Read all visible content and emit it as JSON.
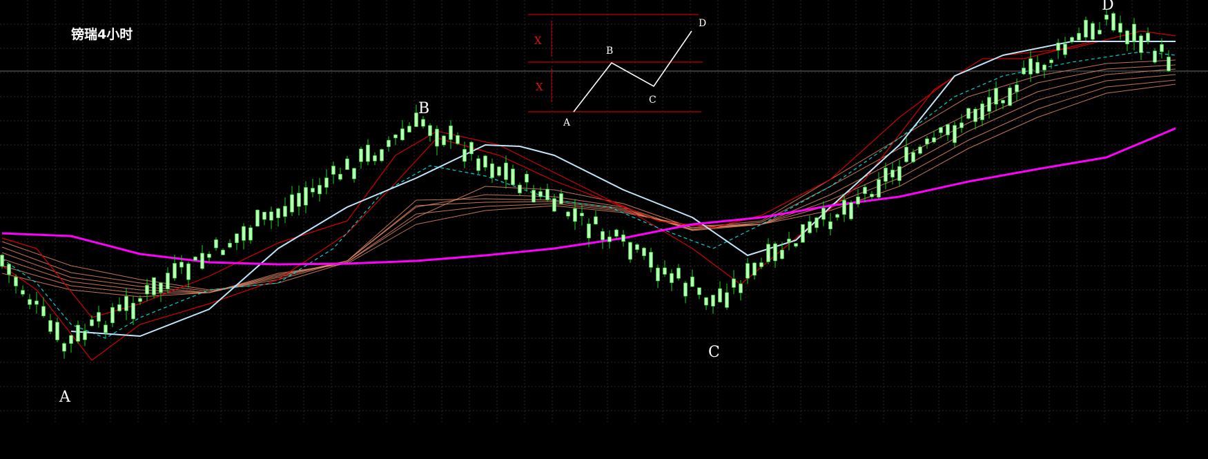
{
  "chart_data": {
    "type": "candlestick",
    "title": "镑瑞4小时",
    "background": "#000000",
    "grid": true,
    "grid_color": "#2a2a2a",
    "colors": {
      "candle": "#b9ffb9",
      "wick": "#21d321",
      "ma_slow": "#ff00ff",
      "ma_light": "#bfe6ff",
      "ma_dashed": "#00d4d4",
      "envelope": "#d40000",
      "ribbon": "#e58a64"
    },
    "wave_points": [
      {
        "label": "A",
        "index": 9,
        "price": 502
      },
      {
        "label": "B",
        "index": 61,
        "price": 177
      },
      {
        "label": "C",
        "index": 103,
        "price": 437
      },
      {
        "label": "D",
        "index": 160,
        "price": 27
      }
    ],
    "series": [
      {
        "type": "ma_slow",
        "points": [
          [
            0,
            338
          ],
          [
            10,
            342
          ],
          [
            20,
            368
          ],
          [
            30,
            380
          ],
          [
            40,
            383
          ],
          [
            50,
            382
          ],
          [
            60,
            378
          ],
          [
            70,
            370
          ],
          [
            80,
            360
          ],
          [
            90,
            345
          ],
          [
            100,
            325
          ],
          [
            110,
            315
          ],
          [
            120,
            298
          ],
          [
            130,
            285
          ],
          [
            140,
            263
          ],
          [
            150,
            245
          ],
          [
            160,
            228
          ],
          [
            170,
            186
          ]
        ]
      },
      {
        "type": "ma_light",
        "points": [
          [
            10,
            480
          ],
          [
            20,
            487
          ],
          [
            30,
            448
          ],
          [
            40,
            360
          ],
          [
            50,
            300
          ],
          [
            60,
            258
          ],
          [
            70,
            210
          ],
          [
            75,
            212
          ],
          [
            80,
            225
          ],
          [
            90,
            275
          ],
          [
            100,
            315
          ],
          [
            108,
            370
          ],
          [
            115,
            348
          ],
          [
            120,
            300
          ],
          [
            130,
            210
          ],
          [
            138,
            110
          ],
          [
            145,
            80
          ],
          [
            155,
            60
          ],
          [
            170,
            60
          ]
        ]
      },
      {
        "type": "ma_dashed",
        "points": [
          [
            0,
            375
          ],
          [
            5,
            410
          ],
          [
            10,
            470
          ],
          [
            15,
            490
          ],
          [
            20,
            460
          ],
          [
            30,
            420
          ],
          [
            40,
            410
          ],
          [
            48,
            360
          ],
          [
            55,
            280
          ],
          [
            62,
            240
          ],
          [
            70,
            255
          ],
          [
            80,
            290
          ],
          [
            88,
            300
          ],
          [
            95,
            330
          ],
          [
            103,
            360
          ],
          [
            110,
            325
          ],
          [
            120,
            270
          ],
          [
            130,
            200
          ],
          [
            138,
            140
          ],
          [
            145,
            110
          ],
          [
            155,
            90
          ],
          [
            165,
            75
          ],
          [
            170,
            80
          ]
        ]
      },
      {
        "type": "envelope",
        "points": [
          [
            0,
            385
          ],
          [
            5,
            420
          ],
          [
            13,
            522
          ],
          [
            20,
            470
          ],
          [
            30,
            440
          ],
          [
            40,
            405
          ],
          [
            50,
            338
          ],
          [
            57,
            265
          ],
          [
            63,
            200
          ],
          [
            72,
            225
          ],
          [
            80,
            262
          ],
          [
            90,
            300
          ],
          [
            100,
            360
          ],
          [
            107,
            412
          ],
          [
            115,
            345
          ],
          [
            125,
            260
          ],
          [
            135,
            130
          ],
          [
            142,
            85
          ],
          [
            148,
            85
          ],
          [
            158,
            60
          ],
          [
            170,
            60
          ]
        ]
      },
      {
        "type": "envelope",
        "points": [
          [
            0,
            345
          ],
          [
            5,
            360
          ],
          [
            13,
            460
          ],
          [
            20,
            440
          ],
          [
            30,
            400
          ],
          [
            40,
            352
          ],
          [
            50,
            320
          ],
          [
            57,
            225
          ],
          [
            63,
            190
          ],
          [
            72,
            210
          ],
          [
            80,
            250
          ],
          [
            88,
            290
          ],
          [
            95,
            320
          ],
          [
            103,
            330
          ],
          [
            110,
            312
          ],
          [
            120,
            260
          ],
          [
            130,
            170
          ],
          [
            138,
            110
          ],
          [
            145,
            80
          ],
          [
            155,
            70
          ],
          [
            165,
            45
          ],
          [
            170,
            52
          ]
        ]
      },
      {
        "type": "ribbon",
        "points": [
          [
            0,
            350
          ],
          [
            10,
            385
          ],
          [
            20,
            405
          ],
          [
            30,
            420
          ],
          [
            40,
            410
          ],
          [
            50,
            380
          ],
          [
            60,
            315
          ],
          [
            70,
            270
          ],
          [
            80,
            275
          ],
          [
            90,
            295
          ],
          [
            100,
            330
          ],
          [
            110,
            320
          ],
          [
            120,
            260
          ],
          [
            130,
            200
          ],
          [
            140,
            140
          ],
          [
            150,
            110
          ],
          [
            160,
            92
          ],
          [
            170,
            87
          ]
        ]
      },
      {
        "type": "ribbon",
        "points": [
          [
            0,
            358
          ],
          [
            10,
            395
          ],
          [
            20,
            410
          ],
          [
            30,
            422
          ],
          [
            40,
            405
          ],
          [
            50,
            378
          ],
          [
            60,
            300
          ],
          [
            70,
            282
          ],
          [
            80,
            285
          ],
          [
            90,
            300
          ],
          [
            100,
            333
          ],
          [
            110,
            322
          ],
          [
            120,
            270
          ],
          [
            130,
            215
          ],
          [
            140,
            165
          ],
          [
            150,
            120
          ],
          [
            160,
            100
          ],
          [
            170,
            94
          ]
        ]
      },
      {
        "type": "ribbon",
        "points": [
          [
            0,
            366
          ],
          [
            10,
            402
          ],
          [
            20,
            415
          ],
          [
            30,
            424
          ],
          [
            40,
            402
          ],
          [
            50,
            378
          ],
          [
            60,
            290
          ],
          [
            70,
            288
          ],
          [
            80,
            290
          ],
          [
            90,
            302
          ],
          [
            100,
            334
          ],
          [
            110,
            325
          ],
          [
            120,
            282
          ],
          [
            130,
            230
          ],
          [
            140,
            178
          ],
          [
            150,
            133
          ],
          [
            160,
            108
          ],
          [
            170,
            100
          ]
        ]
      },
      {
        "type": "ribbon",
        "points": [
          [
            0,
            375
          ],
          [
            10,
            408
          ],
          [
            20,
            420
          ],
          [
            30,
            424
          ],
          [
            40,
            400
          ],
          [
            50,
            378
          ],
          [
            60,
            298
          ],
          [
            70,
            293
          ],
          [
            80,
            292
          ],
          [
            90,
            304
          ],
          [
            100,
            332
          ],
          [
            110,
            325
          ],
          [
            120,
            290
          ],
          [
            130,
            245
          ],
          [
            140,
            190
          ],
          [
            150,
            145
          ],
          [
            160,
            117
          ],
          [
            170,
            108
          ]
        ]
      },
      {
        "type": "ribbon",
        "points": [
          [
            0,
            385
          ],
          [
            10,
            414
          ],
          [
            20,
            425
          ],
          [
            30,
            424
          ],
          [
            40,
            398
          ],
          [
            50,
            380
          ],
          [
            60,
            310
          ],
          [
            70,
            299
          ],
          [
            80,
            295
          ],
          [
            90,
            306
          ],
          [
            100,
            330
          ],
          [
            110,
            325
          ],
          [
            120,
            297
          ],
          [
            130,
            258
          ],
          [
            140,
            203
          ],
          [
            150,
            158
          ],
          [
            160,
            126
          ],
          [
            170,
            116
          ]
        ]
      },
      {
        "type": "ribbon",
        "points": [
          [
            0,
            396
          ],
          [
            10,
            420
          ],
          [
            20,
            430
          ],
          [
            30,
            424
          ],
          [
            40,
            396
          ],
          [
            50,
            382
          ],
          [
            60,
            325
          ],
          [
            70,
            305
          ],
          [
            80,
            298
          ],
          [
            90,
            308
          ],
          [
            100,
            327
          ],
          [
            110,
            325
          ],
          [
            120,
            305
          ],
          [
            130,
            270
          ],
          [
            140,
            215
          ],
          [
            150,
            170
          ],
          [
            160,
            135
          ],
          [
            170,
            122
          ]
        ]
      }
    ]
  },
  "inset": {
    "labels": {
      "a": "A",
      "b": "B",
      "c": "C",
      "d": "D"
    },
    "x_mark": "X"
  }
}
